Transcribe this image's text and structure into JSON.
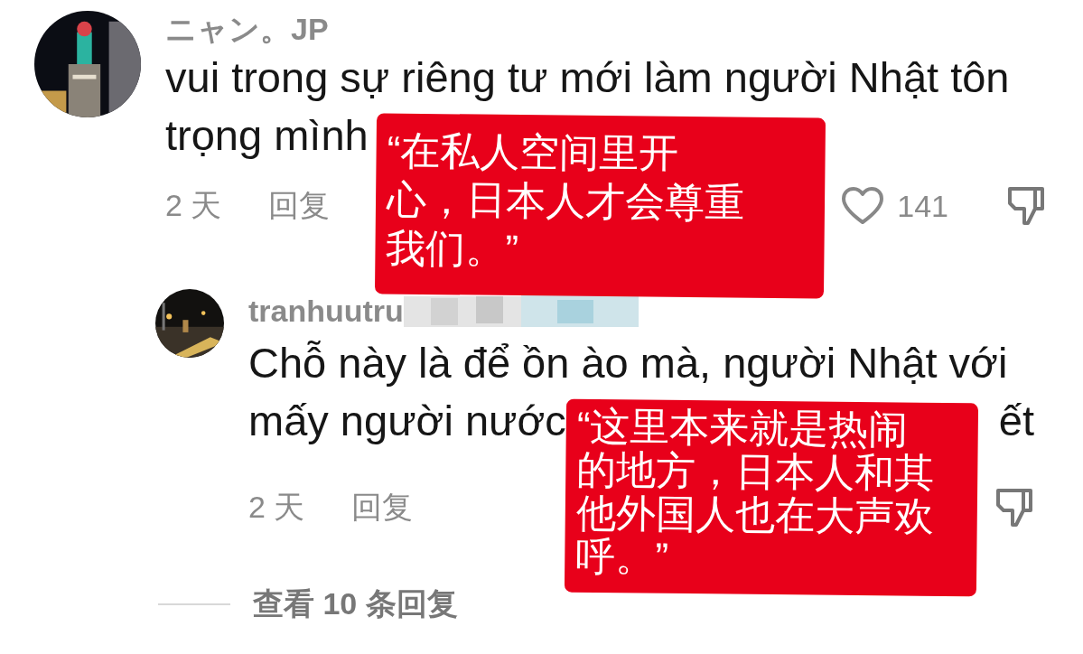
{
  "comments": [
    {
      "username": "ニャン。JP",
      "lines": [
        [
          "vui trong sự riêng tư mới làm người Nhật tôn"
        ],
        [
          "trọng mình"
        ]
      ],
      "time": "2 天",
      "reply": "回复",
      "likes": "141",
      "liked": false,
      "replies": [
        {
          "username": "tranhuutru",
          "username_blurred": true,
          "lines": [
            [
              "Chỗ này là để ồn ào mà, người Nhật với"
            ],
            [
              "mấy người nước",
              "ết"
            ]
          ],
          "time": "2 天",
          "reply": "回复"
        }
      ],
      "view_more": "查看 10 条回复"
    }
  ],
  "annotations": [
    {
      "lines": [
        "“在私人空间里开",
        "心，日本人才会尊重",
        "我们。”"
      ]
    },
    {
      "lines": [
        "“这里本来就是热闹",
        "的地方，日本人和其",
        "他外国人也在大声欢",
        "呼。”"
      ]
    }
  ]
}
